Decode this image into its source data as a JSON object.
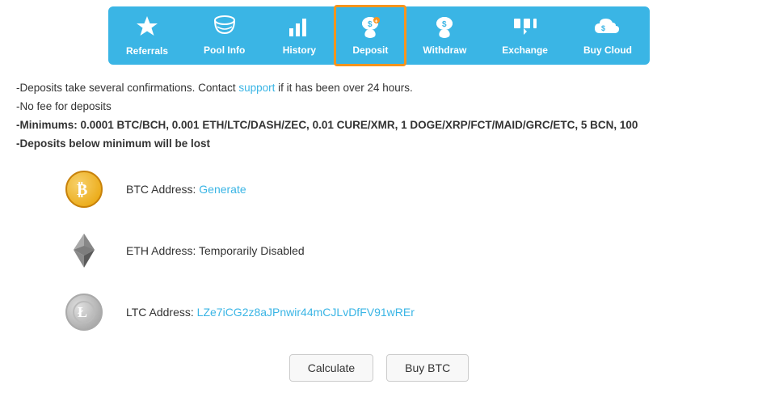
{
  "nav": {
    "items": [
      {
        "id": "referrals",
        "label": "Referrals",
        "icon": "star",
        "active": false
      },
      {
        "id": "pool-info",
        "label": "Pool Info",
        "icon": "cloud",
        "active": false
      },
      {
        "id": "history",
        "label": "History",
        "icon": "bar-chart",
        "active": false
      },
      {
        "id": "deposit",
        "label": "Deposit",
        "icon": "pig",
        "active": true
      },
      {
        "id": "withdraw",
        "label": "Withdraw",
        "icon": "pig-withdraw",
        "active": false
      },
      {
        "id": "exchange",
        "label": "Exchange",
        "icon": "exchange",
        "active": false
      },
      {
        "id": "buy-cloud",
        "label": "Buy Cloud",
        "icon": "cloud-buy",
        "active": false
      }
    ]
  },
  "info": {
    "line1_prefix": "-Deposits take several confirmations. Contact ",
    "line1_link": "support",
    "line1_suffix": " if it has been over 24 hours.",
    "line2": "-No fee for deposits",
    "line3": "-Minimums: 0.0001 BTC/BCH, 0.001 ETH/LTC/DASH/ZEC, 0.01 CURE/XMR, 1 DOGE/XRP/FCT/MAID/GRC/ETC, 5 BCN, 100",
    "line4": "-Deposits below minimum will be lost"
  },
  "coins": [
    {
      "id": "btc",
      "label": "BTC Address: ",
      "value": "Generate",
      "value_type": "link",
      "symbol": "₿"
    },
    {
      "id": "eth",
      "label": "ETH Address: ",
      "value": "Temporarily Disabled",
      "value_type": "text",
      "symbol": "◆"
    },
    {
      "id": "ltc",
      "label": "LTC Address: ",
      "value": "LZe7iCG2z8aJPnwir44mCJLvDfFV91wREr",
      "value_type": "link",
      "symbol": "Ł"
    }
  ],
  "buttons": {
    "calculate": "Calculate",
    "buy_btc": "Buy BTC"
  }
}
